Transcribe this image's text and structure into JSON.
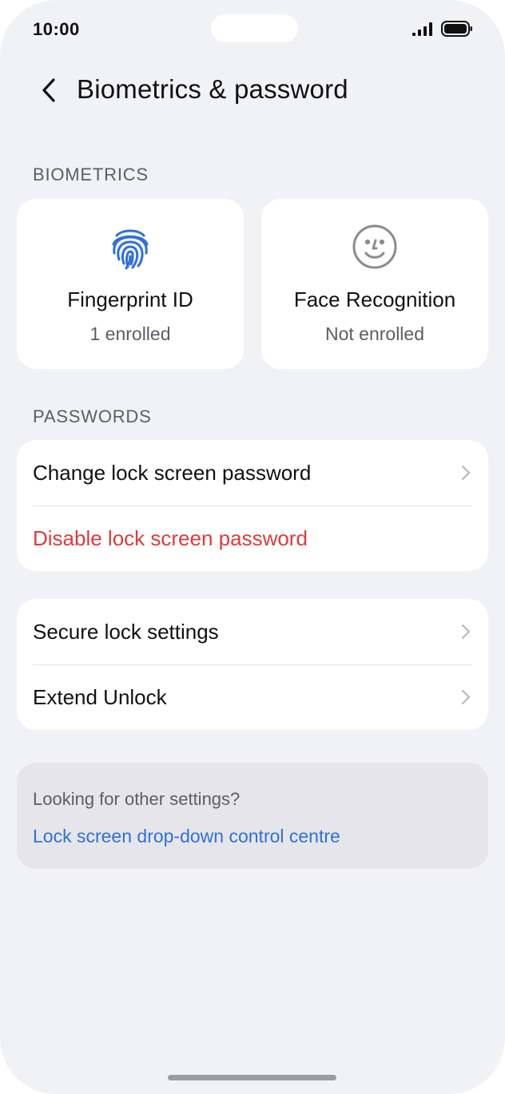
{
  "status_bar": {
    "time": "10:00",
    "icons": [
      "signal-icon",
      "battery-icon"
    ]
  },
  "header": {
    "back_icon": "chevron-left-icon",
    "title": "Biometrics & password"
  },
  "biometrics": {
    "section_label": "BIOMETRICS",
    "tiles": [
      {
        "icon": "fingerprint-icon",
        "title": "Fingerprint ID",
        "subtitle": "1 enrolled",
        "icon_color": "#2f6fd8"
      },
      {
        "icon": "face-icon",
        "title": "Face Recognition",
        "subtitle": "Not enrolled",
        "icon_color": "#8a8b90"
      }
    ]
  },
  "passwords": {
    "section_label": "PASSWORDS",
    "items": [
      {
        "label": "Change lock screen password",
        "has_chevron": true
      },
      {
        "label": "Disable lock screen password",
        "color": "#e0393e",
        "has_chevron": false
      }
    ]
  },
  "security": {
    "items": [
      {
        "label": "Secure lock settings",
        "has_chevron": true
      },
      {
        "label": "Extend Unlock",
        "has_chevron": true
      }
    ]
  },
  "info": {
    "text": "Looking for other settings?",
    "link": "Lock screen drop-down control centre",
    "link_color": "#2f6fd8"
  },
  "theme": {
    "background": "#f1f2f5",
    "card": "#ffffff",
    "accent": "#2f6fd8",
    "danger": "#e0393e"
  }
}
